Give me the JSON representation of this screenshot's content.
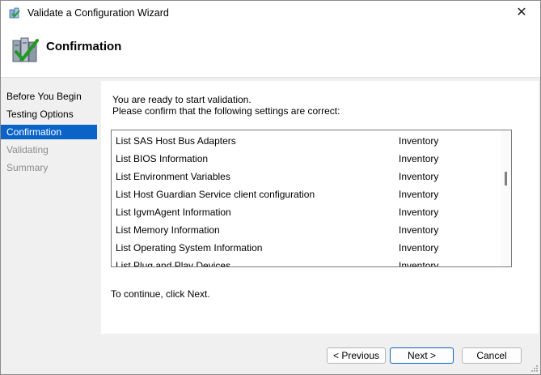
{
  "window": {
    "title": "Validate a Configuration Wizard",
    "close_glyph": "✕"
  },
  "header": {
    "title": "Confirmation",
    "icon": "checklist-icon"
  },
  "steps": [
    {
      "label": "Before You Begin",
      "state": "normal"
    },
    {
      "label": "Testing Options",
      "state": "normal"
    },
    {
      "label": "Confirmation",
      "state": "active"
    },
    {
      "label": "Validating",
      "state": "disabled"
    },
    {
      "label": "Summary",
      "state": "disabled"
    }
  ],
  "content": {
    "intro_line1": "You are ready to start validation.",
    "intro_line2": "Please confirm that the following settings are correct:",
    "tests": [
      {
        "name": "List SAS Host Bus Adapters",
        "category": "Inventory"
      },
      {
        "name": "List BIOS Information",
        "category": "Inventory"
      },
      {
        "name": "List Environment Variables",
        "category": "Inventory"
      },
      {
        "name": "List Host Guardian Service client configuration",
        "category": "Inventory"
      },
      {
        "name": "List IgvmAgent Information",
        "category": "Inventory"
      },
      {
        "name": "List Memory Information",
        "category": "Inventory"
      },
      {
        "name": "List Operating System Information",
        "category": "Inventory"
      },
      {
        "name": "List Plug and Play Devices",
        "category": "Inventory"
      }
    ],
    "continue_text": "To continue, click Next."
  },
  "buttons": {
    "previous": "< Previous",
    "next": "Next >",
    "cancel": "Cancel"
  },
  "colors": {
    "accent": "#0a64c8",
    "panel": "#f0f0f0"
  }
}
